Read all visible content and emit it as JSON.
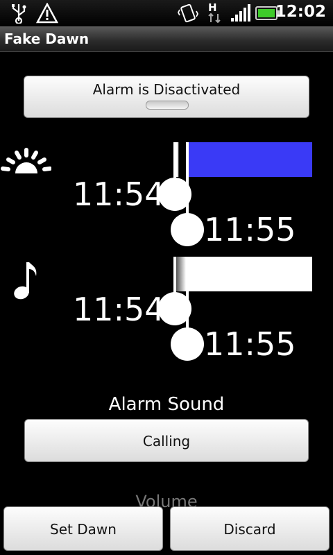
{
  "status_bar": {
    "time": "12:02",
    "icons": [
      "usb-icon",
      "warning-icon",
      "vibrate-icon",
      "hspa-data-icon",
      "signal-icon",
      "battery-icon"
    ],
    "network_label": "H"
  },
  "app": {
    "title": "Fake Dawn"
  },
  "alarm_toggle": {
    "label": "Alarm is Disactivated",
    "active": false
  },
  "light": {
    "icon": "sunrise-icon",
    "start_time": "11:54",
    "end_time": "11:55",
    "color": "#3a3af6"
  },
  "sound": {
    "icon": "music-note-icon",
    "start_time": "11:54",
    "end_time": "11:55",
    "color": "#ffffff"
  },
  "alarm_sound": {
    "heading": "Alarm Sound",
    "value": "Calling"
  },
  "volume": {
    "heading": "Volume"
  },
  "footer": {
    "set_label": "Set Dawn",
    "discard_label": "Discard"
  }
}
